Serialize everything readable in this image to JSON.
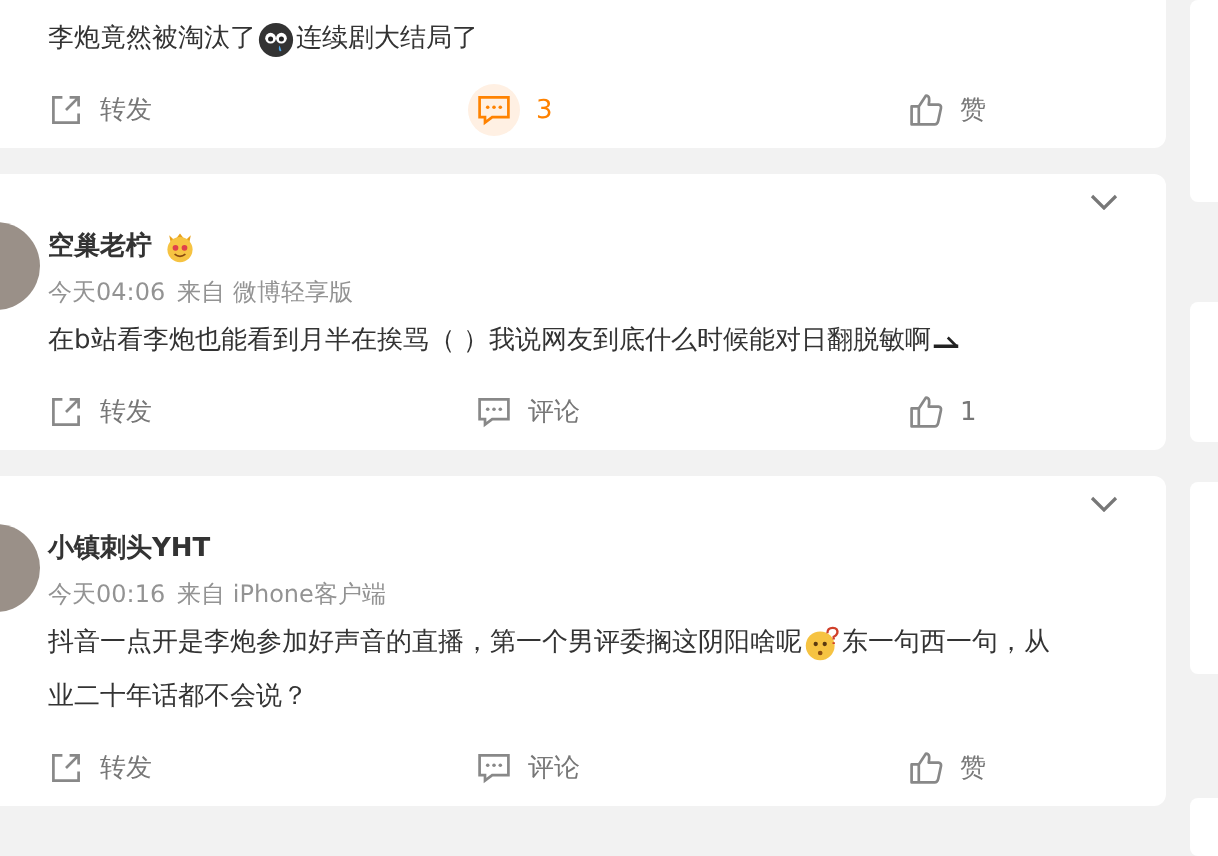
{
  "posts": [
    {
      "body": [
        [
          {
            "kind": "text",
            "text": "李炮竟然被淘汰了"
          },
          {
            "kind": "dark-face"
          },
          {
            "kind": "text",
            "text": "连续剧大结局了"
          }
        ]
      ],
      "actions": [
        {
          "kind": "share",
          "label": "转发",
          "selected": false
        },
        {
          "kind": "comment",
          "label": "3",
          "selected": true
        },
        {
          "kind": "like",
          "label": "赞",
          "selected": false
        }
      ]
    },
    {
      "author": "空巢老柠",
      "author_icons": [
        {
          "kind": "crown-face"
        }
      ],
      "time": "今天04:06",
      "source": "来自 微博轻享版",
      "body": [
        [
          {
            "kind": "text",
            "text": "在b站看李炮也能看到月半在挨骂（ ）我说网友到底什么时候能对日翻脱敏啊"
          },
          {
            "kind": "shades"
          }
        ]
      ],
      "actions": [
        {
          "kind": "share",
          "label": "转发",
          "selected": false
        },
        {
          "kind": "comment",
          "label": "评论",
          "selected": false
        },
        {
          "kind": "like",
          "label": "1",
          "selected": false
        }
      ]
    },
    {
      "author": "小镇刺头YHT",
      "time": "今天00:16",
      "source": "来自 iPhone客户端",
      "body": [
        [
          {
            "kind": "text",
            "text": "抖音一点开是李炮参加好声音的直播，第一个男评委搁这阴阳啥呢"
          },
          {
            "kind": "puzzled-face"
          },
          {
            "kind": "text",
            "text": "东一句西一句，从"
          }
        ],
        [
          {
            "kind": "text",
            "text": "业二十年话都不会说？"
          }
        ]
      ],
      "actions": [
        {
          "kind": "share",
          "label": "转发",
          "selected": false
        },
        {
          "kind": "comment",
          "label": "评论",
          "selected": false
        },
        {
          "kind": "like",
          "label": "赞",
          "selected": false
        }
      ]
    }
  ]
}
